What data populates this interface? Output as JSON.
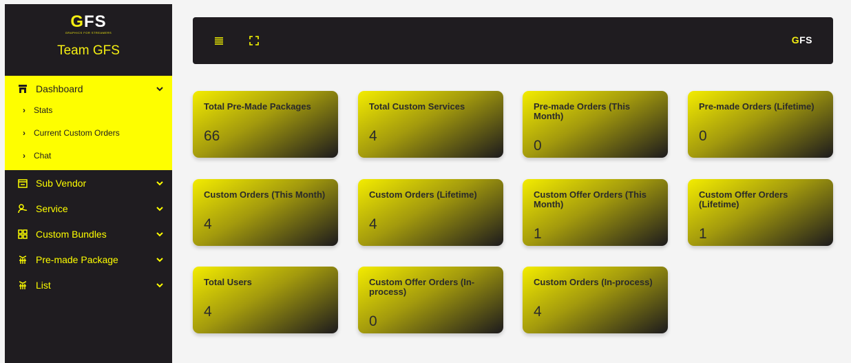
{
  "sidebar": {
    "logo_text": "GFS",
    "logo_tagline": "GRAPHICS FOR STREAMERS",
    "team_name": "Team GFS",
    "dashboard": {
      "label": "Dashboard",
      "icon": "store-icon",
      "subitems": [
        {
          "label": "Stats"
        },
        {
          "label": "Current Custom Orders"
        },
        {
          "label": "Chat"
        }
      ]
    },
    "items": [
      {
        "label": "Sub Vendor",
        "icon": "storefront-icon"
      },
      {
        "label": "Service",
        "icon": "service-icon"
      },
      {
        "label": "Custom Bundles",
        "icon": "bundles-icon"
      },
      {
        "label": "Pre-made Package",
        "icon": "package-icon"
      },
      {
        "label": "List",
        "icon": "list-icon"
      }
    ]
  },
  "topbar": {
    "logo_text": "GFS",
    "menu_icon": "hamburger-icon",
    "fullscreen_icon": "fullscreen-icon"
  },
  "cards": [
    {
      "title": "Total Pre-Made Packages",
      "value": "66"
    },
    {
      "title": "Total Custom Services",
      "value": "4"
    },
    {
      "title": "Pre-made Orders (This Month)",
      "value": "0"
    },
    {
      "title": "Pre-made Orders (Lifetime)",
      "value": "0"
    },
    {
      "title": "Custom Orders (This Month)",
      "value": "4"
    },
    {
      "title": "Custom Orders (Lifetime)",
      "value": "4"
    },
    {
      "title": "Custom Offer Orders (This Month)",
      "value": "1"
    },
    {
      "title": "Custom Offer Orders (Lifetime)",
      "value": "1"
    },
    {
      "title": "Total Users",
      "value": "4"
    },
    {
      "title": "Custom Offer Orders (In-process)",
      "value": "0"
    },
    {
      "title": "Custom Orders (In-process)",
      "value": "4"
    }
  ],
  "colors": {
    "accent": "#fefe00",
    "dark": "#1f1c20",
    "background": "#f4f4f4"
  }
}
